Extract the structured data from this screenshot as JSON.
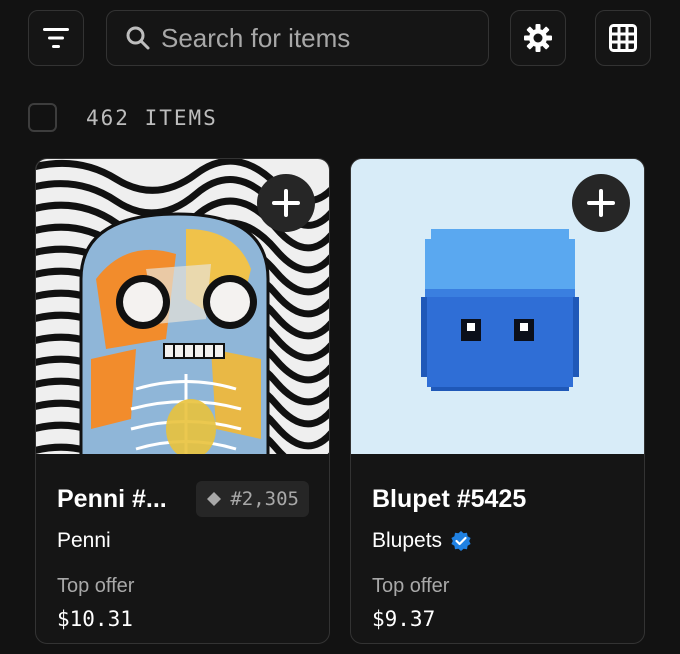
{
  "toolbar": {
    "filter_icon": "filter-lines-icon",
    "search_placeholder": "Search for items",
    "settings_icon": "gear-icon",
    "view_icon": "grid-icon"
  },
  "results": {
    "count_label": "462 ITEMS"
  },
  "items": [
    {
      "title": "Penni #...",
      "rank": "#2,305",
      "collection": "Penni",
      "verified": false,
      "offer_label": "Top offer",
      "price": "$10.31"
    },
    {
      "title": "Blupet #5425",
      "collection": "Blupets",
      "verified": true,
      "offer_label": "Top offer",
      "price": "$9.37",
      "image_bg": "#d8ecf8"
    }
  ],
  "colors": {
    "background": "#121212",
    "verified": "#2081e2"
  }
}
